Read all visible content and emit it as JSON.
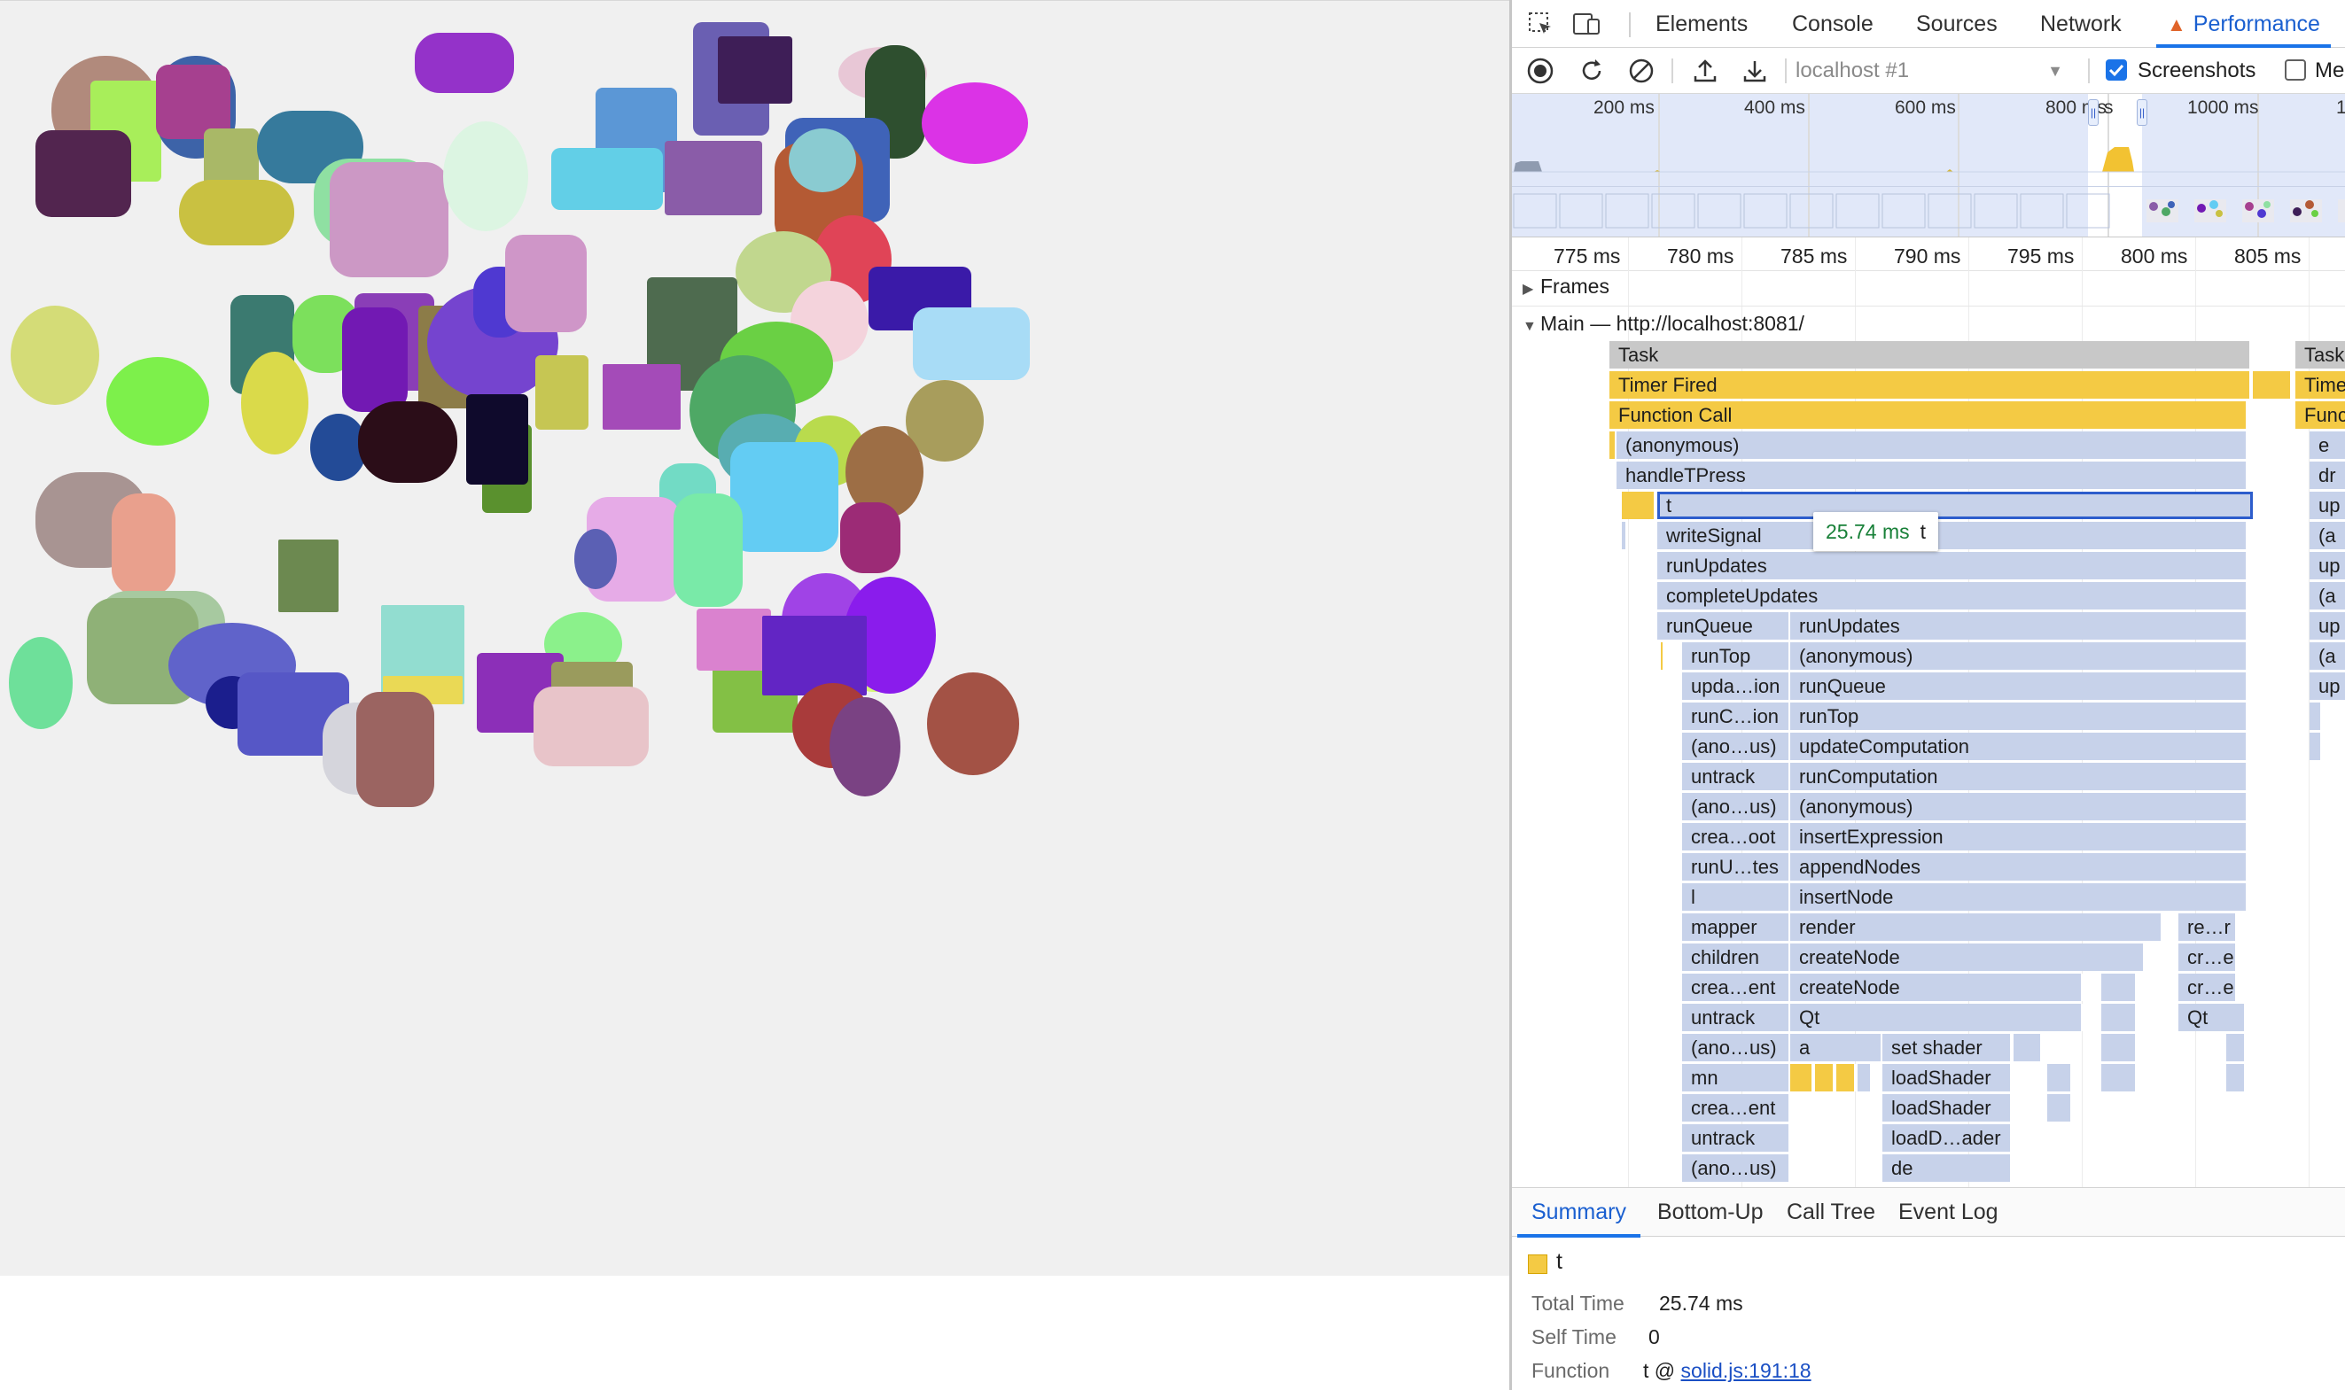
{
  "page": {
    "canvas_background": "#f0f0f0"
  },
  "devtools": {
    "tabs": [
      {
        "label": "Elements",
        "active": false
      },
      {
        "label": "Console",
        "active": false
      },
      {
        "label": "Sources",
        "active": false
      },
      {
        "label": "Network",
        "active": false
      },
      {
        "label": "Performance",
        "active": true,
        "icon": "warning-icon"
      }
    ],
    "toolbar": {
      "record_icon": "record-icon",
      "reload_icon": "reload-record-icon",
      "clear_icon": "clear-icon",
      "upload_icon": "upload-icon",
      "download_icon": "download-icon",
      "target": "localhost #1",
      "screenshots_label": "Screenshots",
      "screenshots_checked": true,
      "memory_label": "Me",
      "memory_checked": false
    },
    "overview": {
      "ticks": [
        "200 ms",
        "400 ms",
        "600 ms",
        "800 ms",
        "1000 ms",
        "1"
      ],
      "selection_label": "s"
    },
    "ruler": {
      "ticks": [
        "775 ms",
        "780 ms",
        "785 ms",
        "790 ms",
        "795 ms",
        "800 ms",
        "805 ms"
      ]
    },
    "tracks": {
      "frames": "Frames",
      "main": "Main — http://localhost:8081/"
    },
    "flame": {
      "top": [
        {
          "label": "Task",
          "cls": "gray"
        },
        {
          "label": "Timer Fired",
          "cls": "yellow"
        },
        {
          "label": "Function Call",
          "cls": "yellow"
        },
        {
          "label": "(anonymous)",
          "cls": ""
        },
        {
          "label": "handleTPress",
          "cls": ""
        },
        {
          "label": "t",
          "cls": "sel"
        },
        {
          "label": "writeSignal",
          "cls": ""
        },
        {
          "label": "runUpdates",
          "cls": ""
        },
        {
          "label": "completeUpdates",
          "cls": ""
        }
      ],
      "runqueue_col": [
        "runQueue",
        "runTop",
        "upda…ion",
        "runC…ion",
        "(ano…us)",
        "untrack",
        "(ano…us)",
        "crea…oot",
        "runU…tes",
        "l",
        "mapper",
        "children",
        "crea…ent",
        "untrack",
        "(ano…us)",
        "mn",
        "crea…ent",
        "untrack",
        "(ano…us)"
      ],
      "runupdates_col": [
        "runUpdates",
        "(anonymous)",
        "runQueue",
        "runTop",
        "updateComputation",
        "runComputation",
        "(anonymous)",
        "insertExpression",
        "appendNodes",
        "insertNode",
        "render",
        "createNode",
        "createNode",
        "Qt",
        "a"
      ],
      "shader_col": [
        "set shader",
        "loadShader",
        "loadShader",
        "loadD…ader",
        "de"
      ],
      "right_col": [
        "re…r",
        "cr…e",
        "cr…e",
        "Qt"
      ],
      "task2": [
        "Task",
        "Timer",
        "Funct"
      ],
      "far_right": [
        "e",
        "dr",
        "up",
        "(a",
        "up",
        "(a",
        "up",
        "(a",
        "up"
      ]
    },
    "tooltip": {
      "time": "25.74 ms",
      "name": "t"
    },
    "bottom_tabs": [
      "Summary",
      "Bottom-Up",
      "Call Tree",
      "Event Log"
    ],
    "summary": {
      "name": "t",
      "total_time_key": "Total Time",
      "total_time": "25.74 ms",
      "self_time_key": "Self Time",
      "self_time": "0",
      "function_key": "Function",
      "function_prefix": "t @ ",
      "function_link": "solid.js:191:18"
    }
  }
}
